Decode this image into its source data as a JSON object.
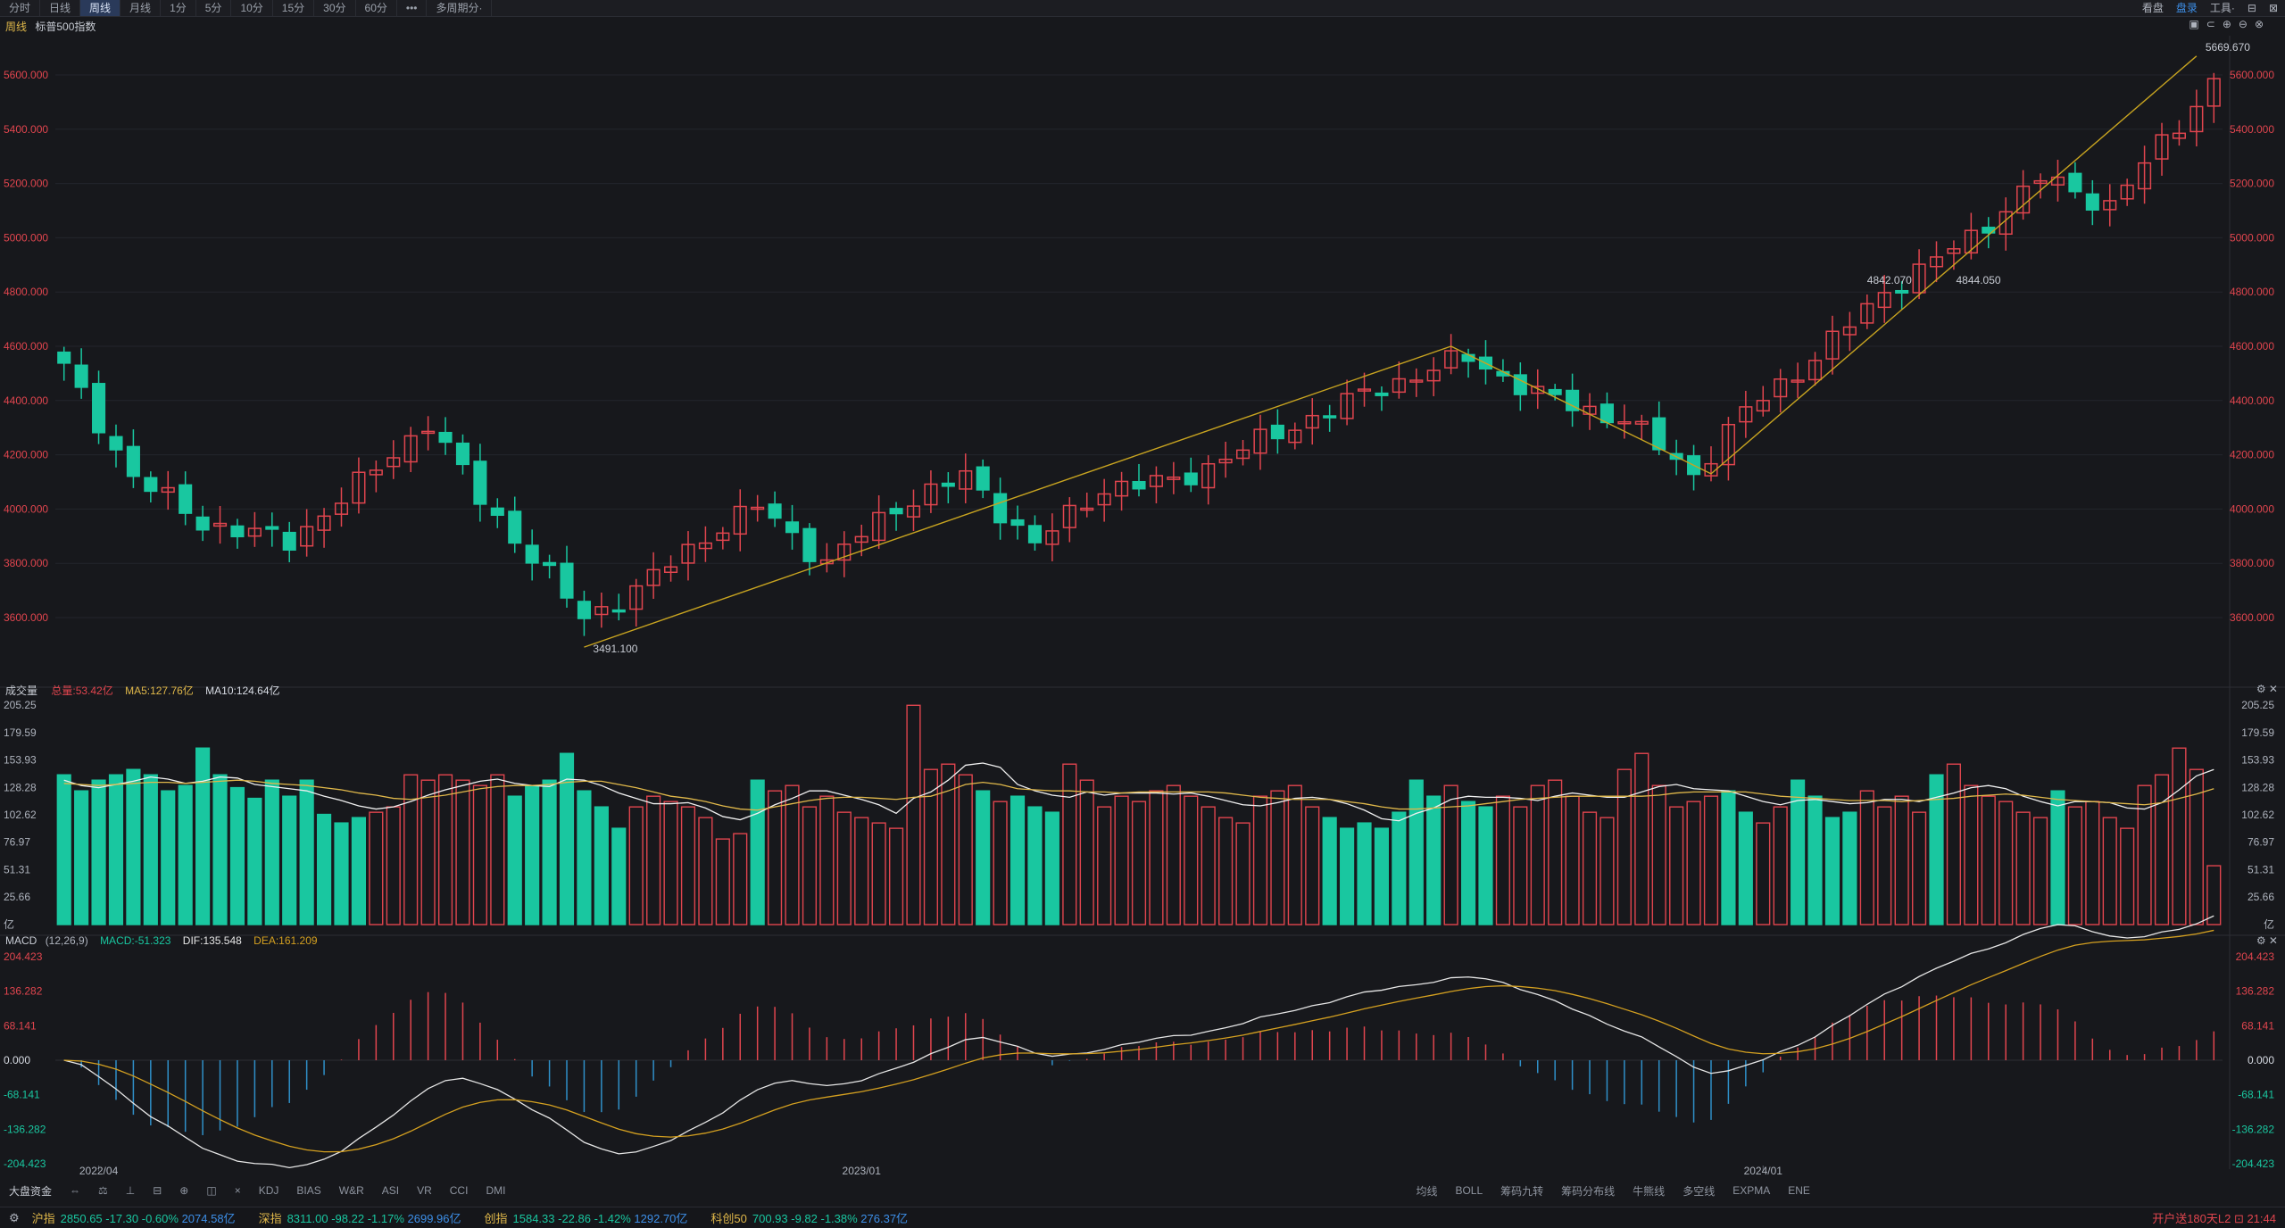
{
  "toolbar": {
    "tabs": [
      "分时",
      "日线",
      "周线",
      "月线",
      "1分",
      "5分",
      "10分",
      "15分",
      "30分",
      "60分",
      "•••",
      "多周期分·"
    ],
    "active_index": 2,
    "right_items": [
      "看盘",
      "盘录",
      "工具·",
      "⊟",
      "⊠"
    ]
  },
  "main_chart": {
    "period_tag": "周线",
    "title": "标普500指数",
    "controls": [
      "▣",
      "⊂",
      "⊕",
      "⊖",
      "⊗"
    ],
    "y_labels": [
      "5600.000",
      "5400.000",
      "5200.000",
      "5000.000",
      "4800.000",
      "4600.000",
      "4400.000",
      "4200.000",
      "4000.000",
      "3800.000",
      "3600.000"
    ],
    "annotations": [
      {
        "text": "5669.670",
        "kind": "high"
      },
      {
        "text": "3491.100",
        "kind": "low"
      },
      {
        "text": "4842.070",
        "kind": "point"
      },
      {
        "text": "4844.050",
        "kind": "point"
      }
    ]
  },
  "volume_panel": {
    "label": "成交量",
    "total": "总量:53.42亿",
    "ma5": "MA5:127.76亿",
    "ma10": "MA10:124.64亿",
    "y_labels": [
      "205.25",
      "179.59",
      "153.93",
      "128.28",
      "102.62",
      "76.97",
      "51.31",
      "25.66",
      "亿"
    ],
    "volume_series": [
      140,
      125,
      135,
      140,
      145,
      140,
      125,
      130,
      165,
      140,
      128,
      118,
      135,
      120,
      135,
      103,
      95,
      100,
      105,
      110,
      140,
      135,
      140,
      135,
      130,
      140,
      120,
      130,
      135,
      160,
      125,
      110,
      90,
      110,
      120,
      115,
      110,
      100,
      80,
      85,
      135,
      125,
      130,
      110,
      120,
      105,
      100,
      95,
      90,
      205,
      145,
      150,
      140,
      125,
      115,
      120,
      110,
      105,
      150,
      135,
      110,
      120,
      115,
      125,
      130,
      120,
      110,
      100,
      95,
      120,
      125,
      130,
      110,
      100,
      90,
      95,
      90,
      105,
      135,
      120,
      130,
      115,
      110,
      120,
      110,
      130,
      135,
      120,
      105,
      100,
      145,
      160,
      130,
      110,
      115,
      120,
      125,
      105,
      95,
      110,
      135,
      120,
      100,
      105,
      125,
      110,
      120,
      105,
      140,
      150,
      130,
      120,
      115,
      105,
      100,
      125,
      110,
      115,
      100,
      90,
      130,
      140,
      165,
      145,
      55
    ],
    "volume_colors": "ccccccccccccccccccrrrrrrrrcccccccrrrrrrrcrrrrrrrrrrrrcrcccrrrrrrrrrrrrrrrcccccccrccrrrrrrrrrrrrrccrrccccrrrrcrrrrrrcrrrrrrrrrcrrcrcccrrcccccrrcrrrr",
    "ma5_series": [
      135,
      130,
      128,
      131,
      134,
      138,
      136,
      132,
      134,
      138,
      137,
      131,
      129,
      127,
      125,
      120,
      116,
      111,
      108,
      110,
      115,
      121,
      126,
      130,
      134,
      136,
      132,
      130,
      129,
      136,
      135,
      130,
      123,
      118,
      113,
      113,
      114,
      109,
      101,
      98,
      104,
      112,
      118,
      125,
      125,
      121,
      117,
      112,
      104,
      118,
      124,
      135,
      149,
      151,
      147,
      131,
      125,
      121,
      119,
      124,
      121,
      123,
      123,
      123,
      122,
      123,
      120,
      116,
      112,
      111,
      114,
      118,
      119,
      117,
      113,
      107,
      99,
      97,
      104,
      109,
      117,
      120,
      119,
      119,
      118,
      116,
      120,
      123,
      121,
      119,
      119,
      124,
      129,
      131,
      127,
      126,
      125,
      120,
      115,
      112,
      116,
      117,
      115,
      113,
      114,
      117,
      117,
      115,
      119,
      123,
      128,
      130,
      127,
      120,
      115,
      111,
      115,
      115,
      114,
      109,
      108,
      114,
      126,
      139,
      145,
      142,
      114
    ],
    "ma10_series": [
      132,
      131,
      130,
      131,
      132,
      133,
      133,
      132,
      133,
      134,
      135,
      134,
      132,
      131,
      130,
      128,
      126,
      123,
      121,
      118,
      117,
      119,
      121,
      124,
      127,
      129,
      130,
      130,
      131,
      133,
      134,
      134,
      131,
      128,
      124,
      120,
      118,
      115,
      111,
      108,
      107,
      110,
      113,
      116,
      118,
      119,
      119,
      118,
      117,
      119,
      120,
      125,
      131,
      133,
      131,
      127,
      126,
      125,
      125,
      124,
      124,
      123,
      124,
      124,
      124,
      124,
      124,
      123,
      121,
      119,
      118,
      117,
      117,
      117,
      115,
      113,
      110,
      108,
      108,
      109,
      110,
      111,
      113,
      115,
      117,
      118,
      119,
      120,
      120,
      120,
      120,
      120,
      121,
      123,
      124,
      124,
      124,
      124,
      122,
      120,
      119,
      118,
      117,
      116,
      116,
      116,
      115,
      116,
      117,
      118,
      120,
      121,
      122,
      121,
      119,
      117,
      116,
      115,
      114,
      113,
      112,
      114,
      118,
      122,
      127,
      130,
      128
    ]
  },
  "macd_panel": {
    "label": "MACD",
    "params": "(12,26,9)",
    "macd": "MACD:-51.323",
    "dif": "DIF:135.548",
    "dea": "DEA:161.209",
    "y_labels": [
      "204.423",
      "136.282",
      "68.141",
      "0.000",
      "-68.141",
      "-136.282",
      "-204.423"
    ]
  },
  "x_axis": {
    "labels": [
      "2022/04",
      "2023/01",
      "2024/01"
    ]
  },
  "bottom_tabs": {
    "left_label": "大盘资金",
    "left_icons": [
      "⇔",
      "⚖",
      "⊥",
      "⊟",
      "⊕",
      "◫",
      "×"
    ],
    "indicators_left": [
      "KDJ",
      "BIAS",
      "W&R",
      "ASI",
      "VR",
      "CCI",
      "DMI"
    ],
    "indicators_right": [
      "均线",
      "BOLL",
      "筹码九转",
      "筹码分布线",
      "牛熊线",
      "多空线",
      "EXPMA",
      "ENE"
    ]
  },
  "status_bar": {
    "indices": [
      {
        "name": "沪指",
        "price": "2850.65",
        "chg": "-17.30",
        "pct": "-0.60%",
        "amt": "2074.58亿"
      },
      {
        "name": "深指",
        "price": "8311.00",
        "chg": "-98.22",
        "pct": "-1.17%",
        "amt": "2699.96亿"
      },
      {
        "name": "创指",
        "price": "1584.33",
        "chg": "-22.86",
        "pct": "-1.42%",
        "amt": "1292.70亿"
      },
      {
        "name": "科创50",
        "price": "700.93",
        "chg": "-9.82",
        "pct": "-1.38%",
        "amt": "276.37亿"
      }
    ],
    "right_text": "开户送180天L2",
    "time": "21:44"
  },
  "colors": {
    "up": "#e0454e",
    "down": "#19c7a0",
    "trend_line": "#c8a420",
    "ma5": "#f0f0f0",
    "ma10": "#e0b84a",
    "dif": "#e6e6e6",
    "dea": "#d4a020",
    "label_red": "#e0454e",
    "label_green": "#19c7a0"
  }
}
